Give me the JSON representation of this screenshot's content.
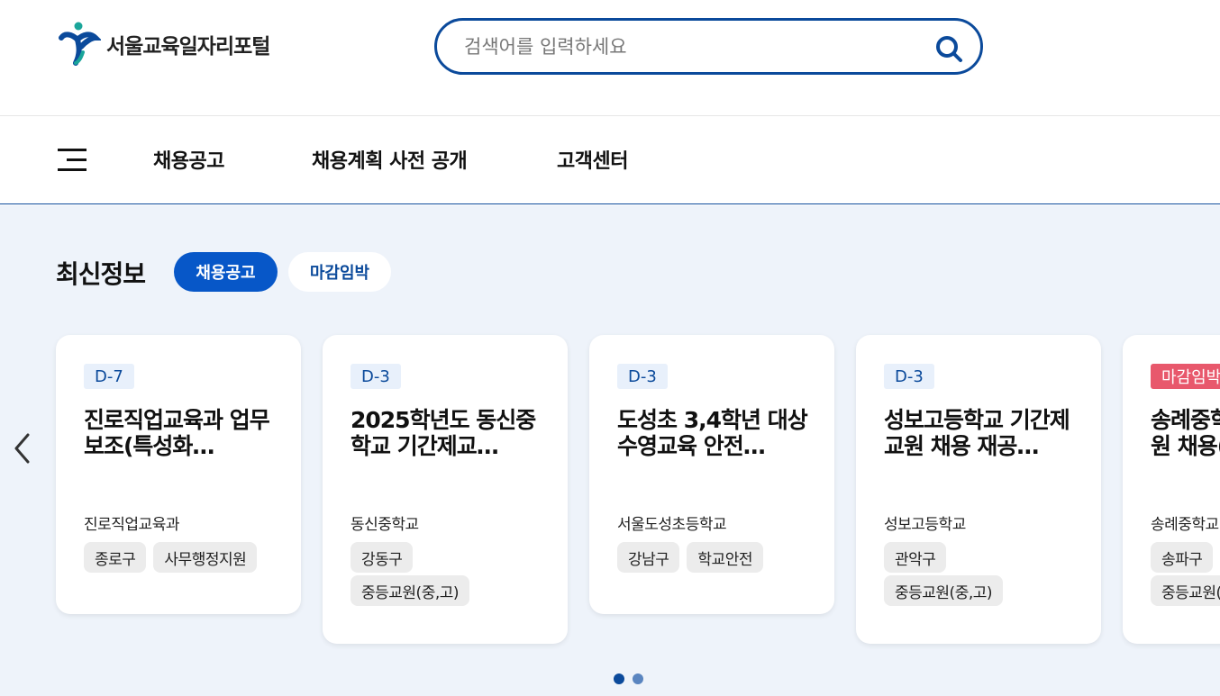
{
  "header": {
    "logo_text": "서울교육일자리포털",
    "search": {
      "placeholder": "검색어를 입력하세요"
    }
  },
  "nav": {
    "items": [
      {
        "label": "채용공고"
      },
      {
        "label": "채용계획 사전 공개"
      },
      {
        "label": "고객센터"
      }
    ]
  },
  "latest": {
    "title": "최신정보",
    "tabs": [
      {
        "label": "채용공고",
        "active": true
      },
      {
        "label": "마감임박",
        "active": false
      }
    ],
    "cards": [
      {
        "dday": "D-7",
        "title": "진로직업교육과 업무 보조(특성화…",
        "org": "진로직업교육과",
        "tags": [
          "종로구",
          "사무행정지원"
        ]
      },
      {
        "dday": "D-3",
        "title": "2025학년도 동신중학교 기간제교…",
        "org": "동신중학교",
        "tags": [
          "강동구",
          "중등교원(중,고)"
        ]
      },
      {
        "dday": "D-3",
        "title": "도성초 3,4학년 대상 수영교육 안전…",
        "org": "서울도성초등학교",
        "tags": [
          "강남구",
          "학교안전"
        ]
      },
      {
        "dday": "D-3",
        "title": "성보고등학교 기간제교원 채용 재공…",
        "org": "성보고등학교",
        "tags": [
          "관악구",
          "중등교원(중,고)"
        ]
      },
      {
        "dday": "마감임박",
        "title": "송례중학교 기간제교원 채용(교…",
        "org": "송례중학교",
        "tags": [
          "송파구",
          "중등교원(중,고)"
        ]
      }
    ],
    "pagination": {
      "current": 1,
      "total": 2
    }
  },
  "colors": {
    "brand": "#0b4a9b",
    "accent": "#0757c8",
    "urgent": "#e8586c",
    "background": "#eef3fa"
  },
  "icons": {
    "logo": "seoul-education-logo-icon",
    "search": "search-icon",
    "menu": "hamburger-menu-icon",
    "prev": "chevron-left-icon"
  }
}
